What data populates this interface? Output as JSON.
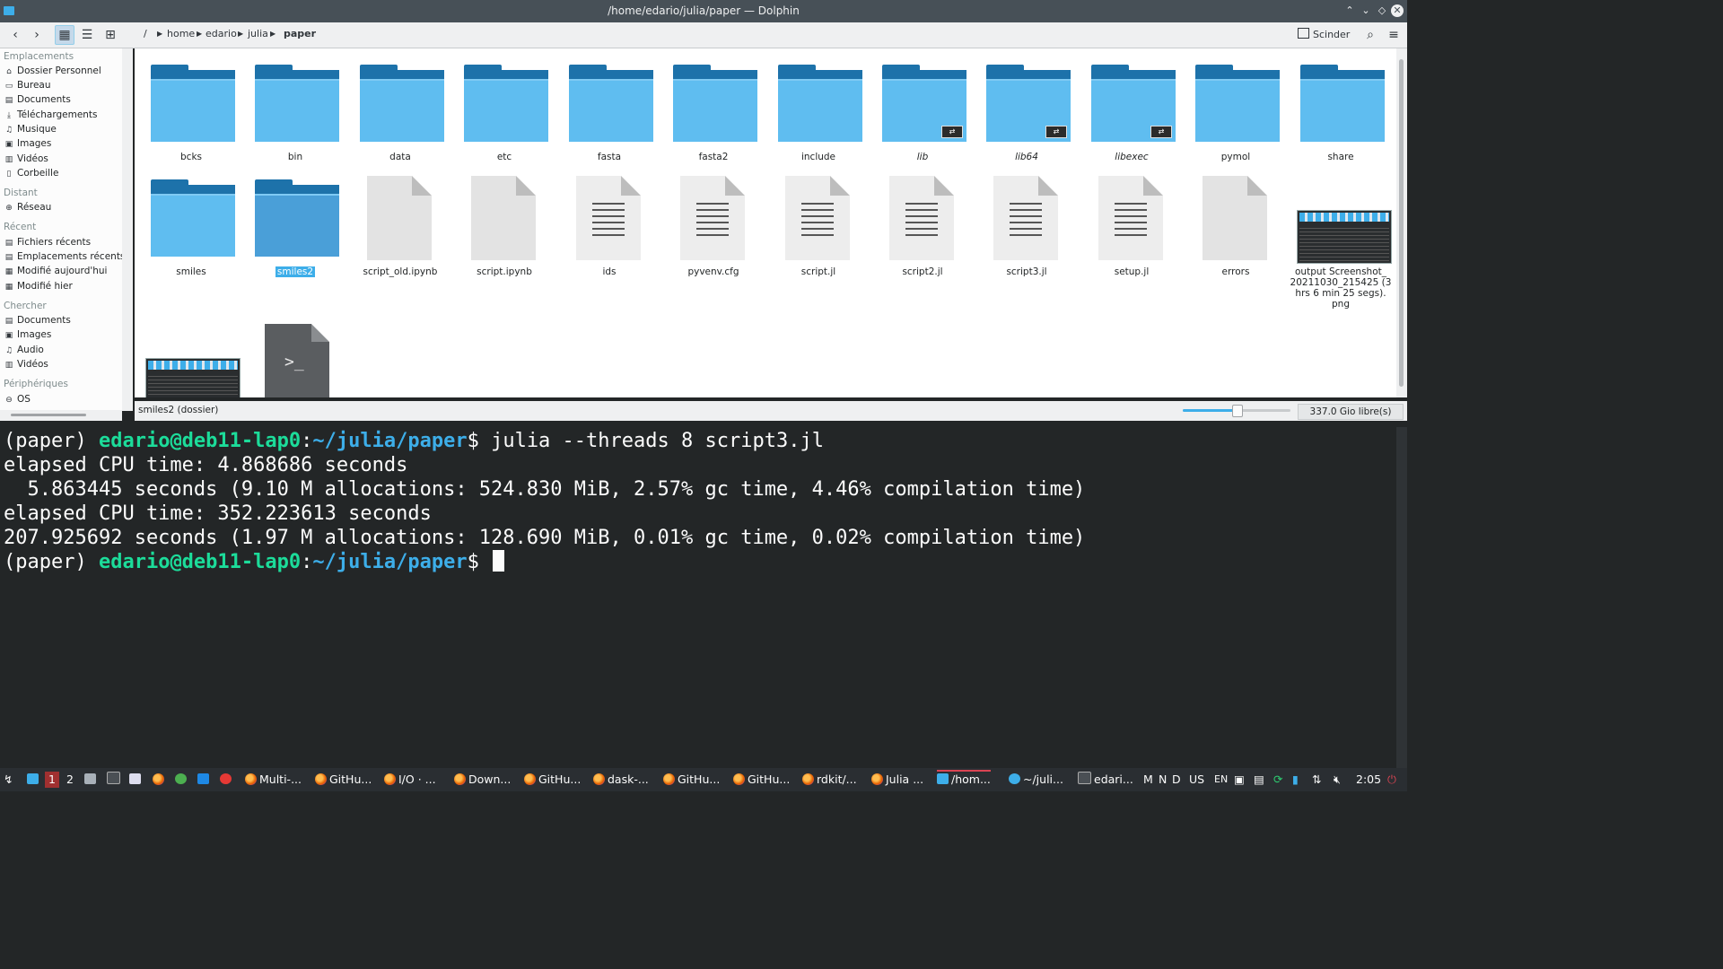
{
  "window": {
    "title": "/home/edario/julia/paper — Dolphin"
  },
  "toolbar": {
    "breadcrumb": [
      "/",
      "home",
      "edario",
      "julia",
      "paper"
    ],
    "split_label": "Scinder"
  },
  "sidebar": {
    "groups": [
      {
        "title": "Emplacements",
        "items": [
          {
            "icon": "home-icon",
            "label": "Dossier Personnel"
          },
          {
            "icon": "desktop-icon",
            "label": "Bureau"
          },
          {
            "icon": "documents-icon",
            "label": "Documents"
          },
          {
            "icon": "downloads-icon",
            "label": "Téléchargements"
          },
          {
            "icon": "music-icon",
            "label": "Musique"
          },
          {
            "icon": "images-icon",
            "label": "Images"
          },
          {
            "icon": "videos-icon",
            "label": "Vidéos"
          },
          {
            "icon": "trash-icon",
            "label": "Corbeille"
          }
        ]
      },
      {
        "title": "Distant",
        "items": [
          {
            "icon": "network-icon",
            "label": "Réseau"
          }
        ]
      },
      {
        "title": "Récent",
        "items": [
          {
            "icon": "recent-files-icon",
            "label": "Fichiers récents"
          },
          {
            "icon": "recent-places-icon",
            "label": "Emplacements récents"
          },
          {
            "icon": "calendar-icon",
            "label": "Modifié aujourd'hui"
          },
          {
            "icon": "calendar-icon",
            "label": "Modifié hier"
          }
        ]
      },
      {
        "title": "Chercher",
        "items": [
          {
            "icon": "documents-icon",
            "label": "Documents"
          },
          {
            "icon": "images-icon",
            "label": "Images"
          },
          {
            "icon": "audio-icon",
            "label": "Audio"
          },
          {
            "icon": "videos-icon",
            "label": "Vidéos"
          }
        ]
      },
      {
        "title": "Périphériques",
        "items": [
          {
            "icon": "drive-icon",
            "label": "OS"
          }
        ]
      }
    ]
  },
  "files": {
    "row1": [
      {
        "name": "bcks",
        "type": "folder"
      },
      {
        "name": "bin",
        "type": "folder"
      },
      {
        "name": "data",
        "type": "folder"
      },
      {
        "name": "etc",
        "type": "folder"
      },
      {
        "name": "fasta",
        "type": "folder"
      },
      {
        "name": "fasta2",
        "type": "folder"
      },
      {
        "name": "include",
        "type": "folder"
      },
      {
        "name": "lib",
        "type": "folder-link"
      },
      {
        "name": "lib64",
        "type": "folder-link"
      },
      {
        "name": "libexec",
        "type": "folder-link"
      },
      {
        "name": "pymol",
        "type": "folder"
      },
      {
        "name": "share",
        "type": "folder"
      }
    ],
    "row2": [
      {
        "name": "smiles",
        "type": "folder"
      },
      {
        "name": "smiles2",
        "type": "folder-selected"
      },
      {
        "name": "script_old.ipynb",
        "type": "blank"
      },
      {
        "name": "script.ipynb",
        "type": "blank"
      },
      {
        "name": "ids",
        "type": "text"
      },
      {
        "name": "pyvenv.cfg",
        "type": "text"
      },
      {
        "name": "script.jl",
        "type": "text"
      },
      {
        "name": "script2.jl",
        "type": "text"
      },
      {
        "name": "script3.jl",
        "type": "text"
      },
      {
        "name": "setup.jl",
        "type": "text"
      },
      {
        "name": "errors",
        "type": "blank"
      },
      {
        "name_lines": [
          "output Screenshot_",
          "20211030_215425 (3",
          "hrs 6 min 25 segs).",
          "png"
        ],
        "type": "image"
      }
    ],
    "row3": [
      {
        "type": "image"
      },
      {
        "type": "terminal-script",
        "glyph": ">_"
      }
    ]
  },
  "statusbar": {
    "selection": "smiles2 (dossier)",
    "zoom_fraction": 0.5,
    "free_space": "337.0 Gio libre(s)"
  },
  "terminal": {
    "lines": [
      {
        "kind": "prompt",
        "env": "(paper) ",
        "user": "edario@deb11-lap0",
        "sep": ":",
        "path": "~/julia/paper",
        "dollar": "$ ",
        "cmd": "julia --threads 8 script3.jl"
      },
      {
        "kind": "out",
        "text": "elapsed CPU time: 4.868686 seconds"
      },
      {
        "kind": "out",
        "text": "  5.863445 seconds (9.10 M allocations: 524.830 MiB, 2.57% gc time, 4.46% compilation time)"
      },
      {
        "kind": "out",
        "text": "elapsed CPU time: 352.223613 seconds"
      },
      {
        "kind": "out",
        "text": "207.925692 seconds (1.97 M allocations: 128.690 MiB, 0.01% gc time, 0.02% compilation time)"
      },
      {
        "kind": "prompt",
        "env": "(paper) ",
        "user": "edario@deb11-lap0",
        "sep": ":",
        "path": "~/julia/paper",
        "dollar": "$ ",
        "cmd": ""
      }
    ]
  },
  "taskbar": {
    "desktops": [
      "1",
      "2"
    ],
    "tasks": [
      "Multi-...",
      "GitHu...",
      "I/O · ...",
      "Down...",
      "GitHu...",
      "dask-...",
      "GitHu...",
      "GitHu...",
      "rdkit/...",
      "Julia ...",
      "/hom...",
      "~/juli...",
      "edari..."
    ],
    "tray_text": [
      "M",
      "N",
      "D",
      "US",
      "EN"
    ],
    "clock": "2:05"
  },
  "colors": {
    "accent": "#3daee9",
    "folder": "#5fbdf0",
    "prompt_user": "#1cdc9a",
    "terminal_bg": "#232627",
    "active_task": "#da4453"
  }
}
